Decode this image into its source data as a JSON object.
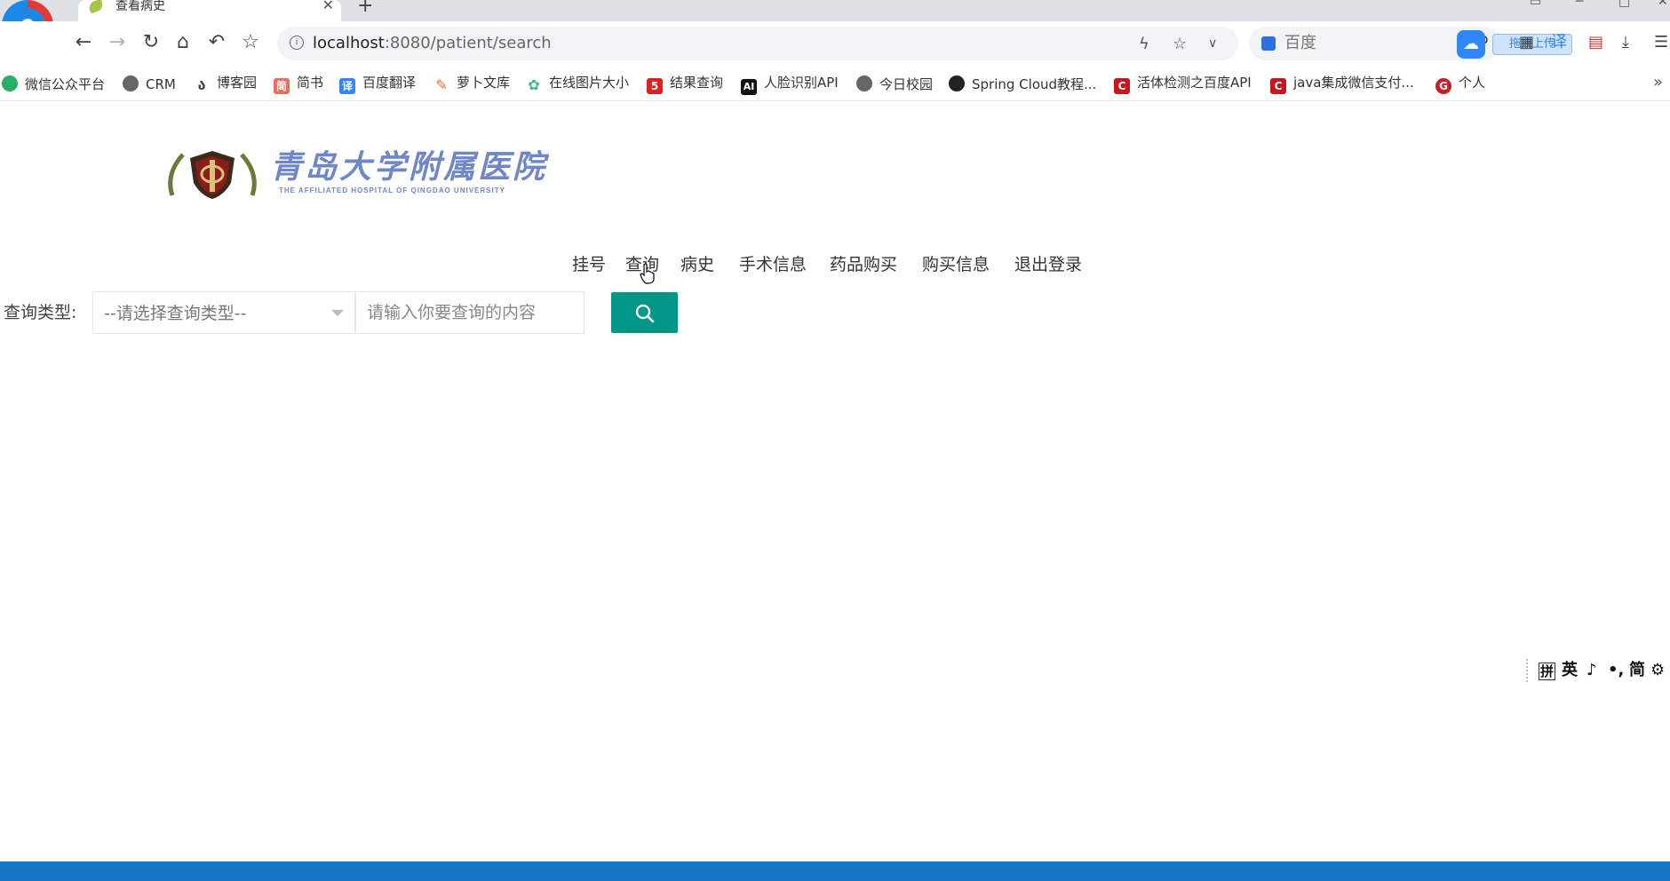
{
  "browser": {
    "tab_title": "查看病史",
    "tab_close": "✕",
    "new_tab": "+",
    "url_host": "localhost",
    "url_rest": ":8080/patient/search",
    "search_engine_placeholder": "百度",
    "upload_label": "拖拽上传",
    "nav_icons": [
      "back-icon",
      "forward-icon",
      "reload-icon",
      "home-icon",
      "undo-icon",
      "star-icon"
    ]
  },
  "bookmarks": [
    {
      "label": "微信公众平台",
      "icon": "wechat-icon",
      "color": "#2aae67"
    },
    {
      "label": "CRM",
      "icon": "globe-icon",
      "color": "#555555"
    },
    {
      "label": "博客园",
      "icon": "cnblogs-icon",
      "color": "#444444"
    },
    {
      "label": "简书",
      "icon": "jianshu-icon",
      "color": "#ea6f5a"
    },
    {
      "label": "百度翻译",
      "icon": "translate-icon",
      "color": "#2f86f6"
    },
    {
      "label": "萝卜文库",
      "icon": "carrot-icon",
      "color": "#e8663c"
    },
    {
      "label": "在线图片大小",
      "icon": "flower-icon",
      "color": "#3fb68b"
    },
    {
      "label": "结果查询",
      "icon": "five-icon",
      "color": "#e02020"
    },
    {
      "label": "人脸识别API",
      "icon": "ai-icon",
      "color": "#111111"
    },
    {
      "label": "今日校园",
      "icon": "globe-icon",
      "color": "#555555"
    },
    {
      "label": "Spring Cloud教程...",
      "icon": "github-icon",
      "color": "#222222"
    },
    {
      "label": "活体检测之百度API",
      "icon": "csdn-icon",
      "color": "#c8161d"
    },
    {
      "label": "java集成微信支付...",
      "icon": "csdn-icon",
      "color": "#c8161d"
    },
    {
      "label": "个人",
      "icon": "gitee-icon",
      "color": "#c71d23"
    }
  ],
  "bookmarks_more": "»",
  "logo": {
    "title": "青岛大学附属医院",
    "subtitle": "THE AFFILIATED HOSPITAL OF QINGDAO UNIVERSITY"
  },
  "nav": {
    "items": [
      "挂号",
      "查询",
      "病史",
      "手术信息",
      "药品购买",
      "购买信息",
      "退出登录"
    ]
  },
  "query": {
    "label": "查询类型:",
    "select_value": "--请选择查询类型--",
    "input_placeholder": "请输入你要查询的内容"
  },
  "colors": {
    "primary_button": "#009688",
    "footer": "#1676c4"
  },
  "ime": [
    "拼",
    "英",
    "♪",
    "•,",
    "简",
    "⚙"
  ]
}
